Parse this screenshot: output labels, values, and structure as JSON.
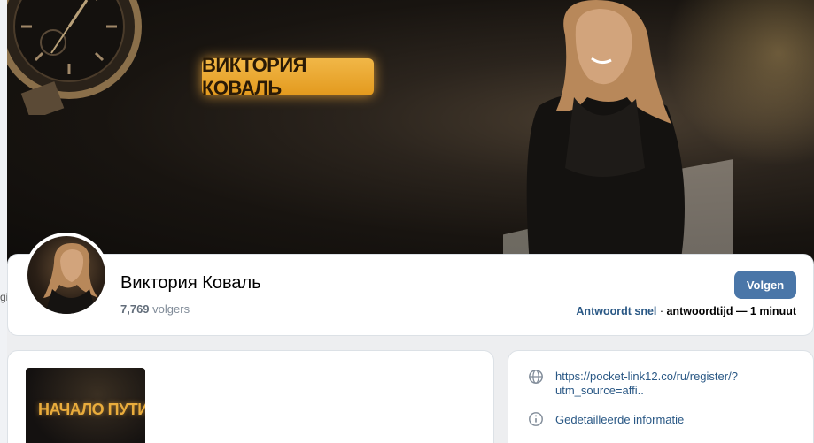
{
  "left_strip": {
    "partial_text": "gieën"
  },
  "cover": {
    "badge_text": "ВИКТОРИЯ КОВАЛЬ"
  },
  "profile": {
    "name": "Виктория Коваль",
    "followers_count": "7,769",
    "followers_label": "volgers",
    "follow_button": "Volgen",
    "reply_fast": "Antwoordt snel",
    "reply_sep": " · ",
    "reply_rest": "antwoordtijd — 1 minuut"
  },
  "post": {
    "thumb_text": "НАЧАЛО ПУТИ!"
  },
  "info": {
    "link_url": "https://pocket-link12.co/ru/register/?utm_source=affi..",
    "details_label": "Gedetailleerde informatie",
    "icons": {
      "link": "globe-icon",
      "details": "info-icon"
    }
  },
  "colors": {
    "accent": "#4a76a8",
    "link": "#2a5885",
    "badge": "#f1b747",
    "muted": "#818c99"
  }
}
